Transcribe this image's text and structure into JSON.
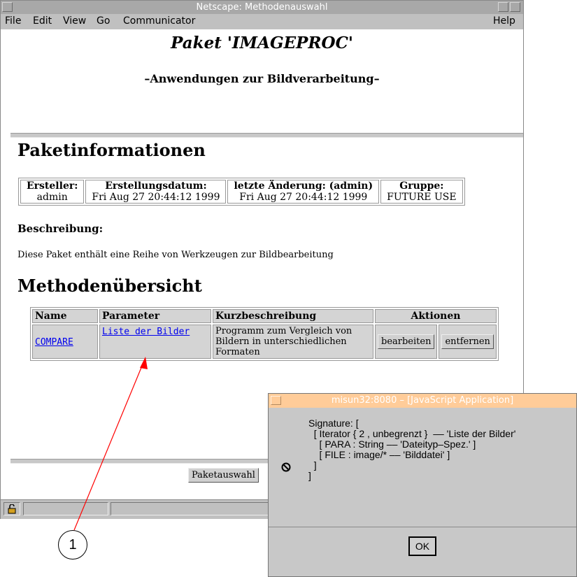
{
  "window": {
    "title": "Netscape: Methodenauswahl"
  },
  "menu": [
    "File",
    "Edit",
    "View",
    "Go",
    "Communicator"
  ],
  "menu_help": "Help",
  "page": {
    "title": "Paket 'IMAGEPROC'",
    "subtitle": "–Anwendungen zur Bildverarbeitung–",
    "section_info": "Paketinformationen",
    "info_headers": [
      "Ersteller:",
      "Erstellungsdatum:",
      "letzte Änderung: (admin)",
      "Gruppe:"
    ],
    "info_values": [
      "admin",
      "Fri Aug 27 20:44:12 1999",
      "Fri Aug 27 20:44:12 1999",
      "FUTURE USE"
    ],
    "beschreibung_label": "Beschreibung:",
    "beschreibung_text": "Diese Paket enthält eine Reihe von Werkzeugen zur Bildbearbeitung",
    "section_methods": "Methodenübersicht",
    "method_headers": [
      "Name",
      "Parameter",
      "Kurzbeschreibung",
      "Aktionen"
    ],
    "method_row": {
      "name": "COMPARE",
      "parameter": "Liste der Bilder",
      "description": [
        "Programm zum Vergleich von",
        "Bildern in unterschiedlichen",
        "Formaten"
      ],
      "edit_button": "bearbeiten",
      "remove_button": "entfernen"
    },
    "package_button": "Paketauswahl"
  },
  "dialog": {
    "title": "misun32:8080 – [JavaScript Application]",
    "lines": [
      "Signature: [",
      "  [ Iterator { 2 , unbegrenzt }  –– 'Liste der Bilder'",
      "    [ PARA : String –– 'Dateityp–Spez.' ]",
      "    [ FILE : image/* –– 'Bilddatei' ]",
      "  ]",
      "]"
    ],
    "ok_label": "OK"
  },
  "callout": {
    "number": "1"
  },
  "colors": {
    "titlebar": "#a8a8a8",
    "dialog_titlebar": "#ffcc99",
    "link": "#0000ee",
    "chrome": "#c0c0c0"
  }
}
